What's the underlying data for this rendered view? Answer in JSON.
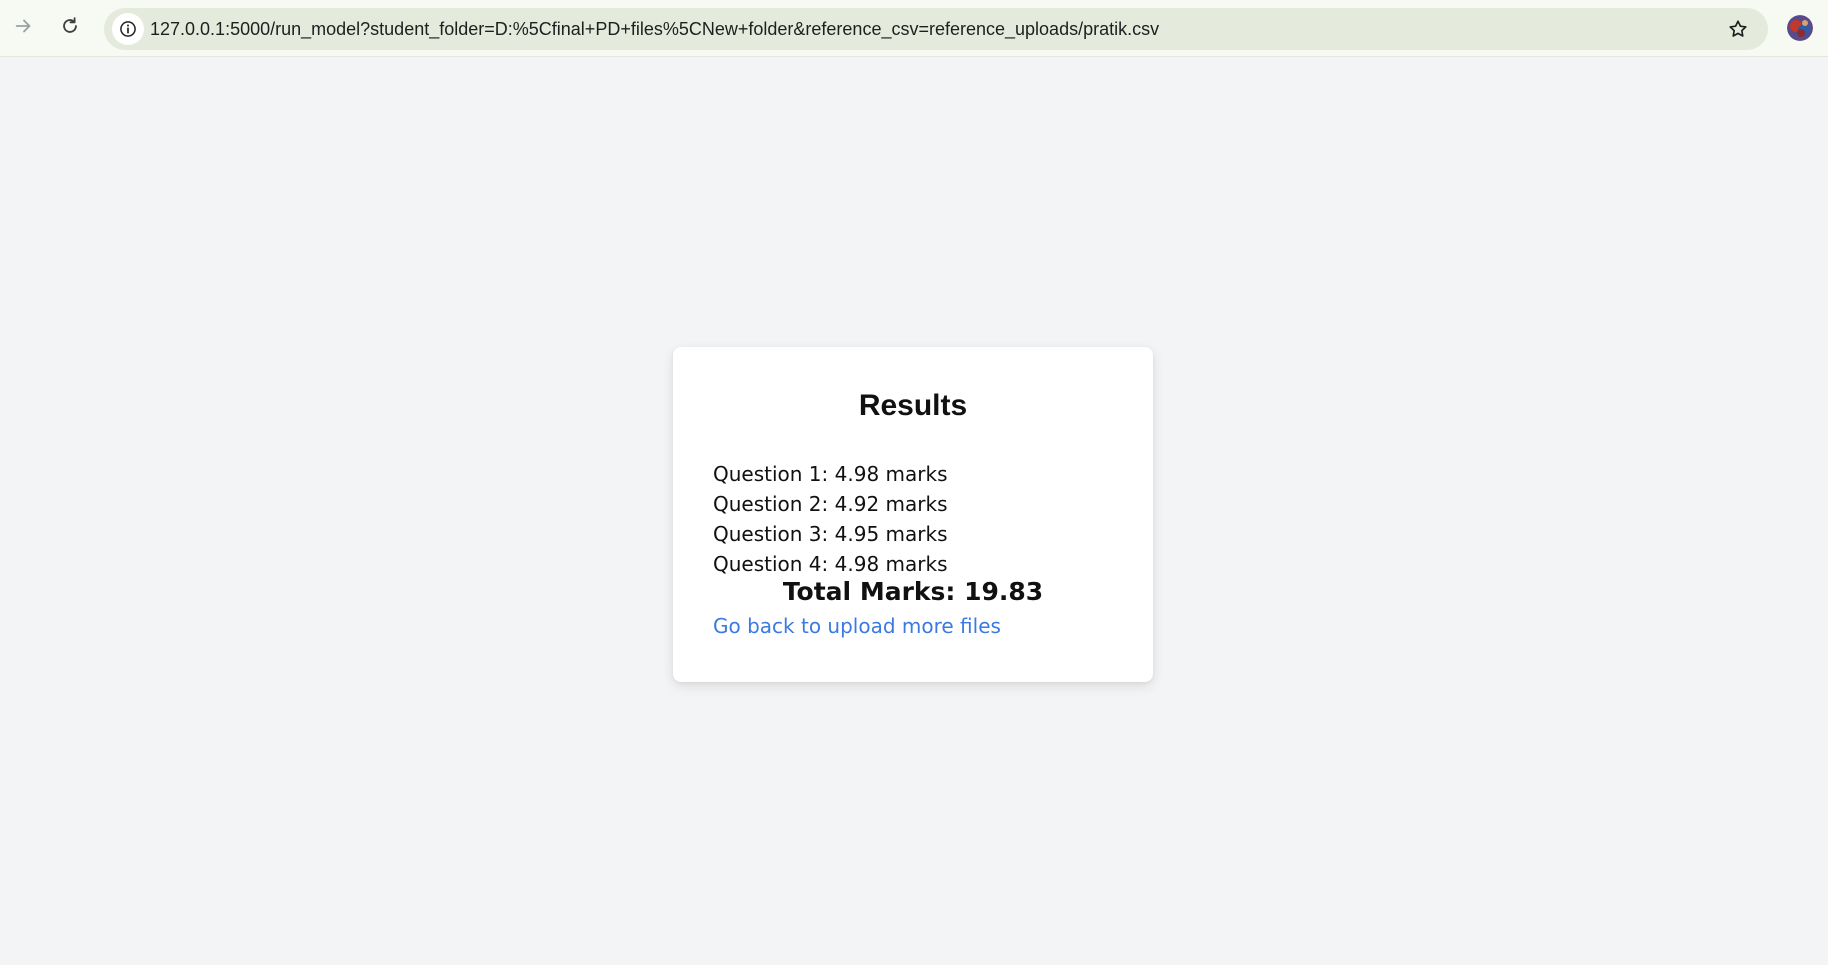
{
  "browser": {
    "url": "127.0.0.1:5000/run_model?student_folder=D:%5Cfinal+PD+files%5CNew+folder&reference_csv=reference_uploads/pratik.csv",
    "icons": {
      "forward": "arrow-right-icon",
      "reload": "reload-icon",
      "site_info": "info-icon",
      "bookmark": "star-icon",
      "profile": "avatar"
    }
  },
  "results": {
    "title": "Results",
    "questions": [
      "Question 1: 4.98 marks",
      "Question 2: 4.92 marks",
      "Question 3: 4.95 marks",
      "Question 4: 4.98 marks"
    ],
    "total": "Total Marks: 19.83",
    "back_link": "Go back to upload more files"
  },
  "colors": {
    "page_background": "#f3f4f6",
    "card_background": "#ffffff",
    "link": "#3b7ae0",
    "omnibox": "#e4ebdc"
  }
}
